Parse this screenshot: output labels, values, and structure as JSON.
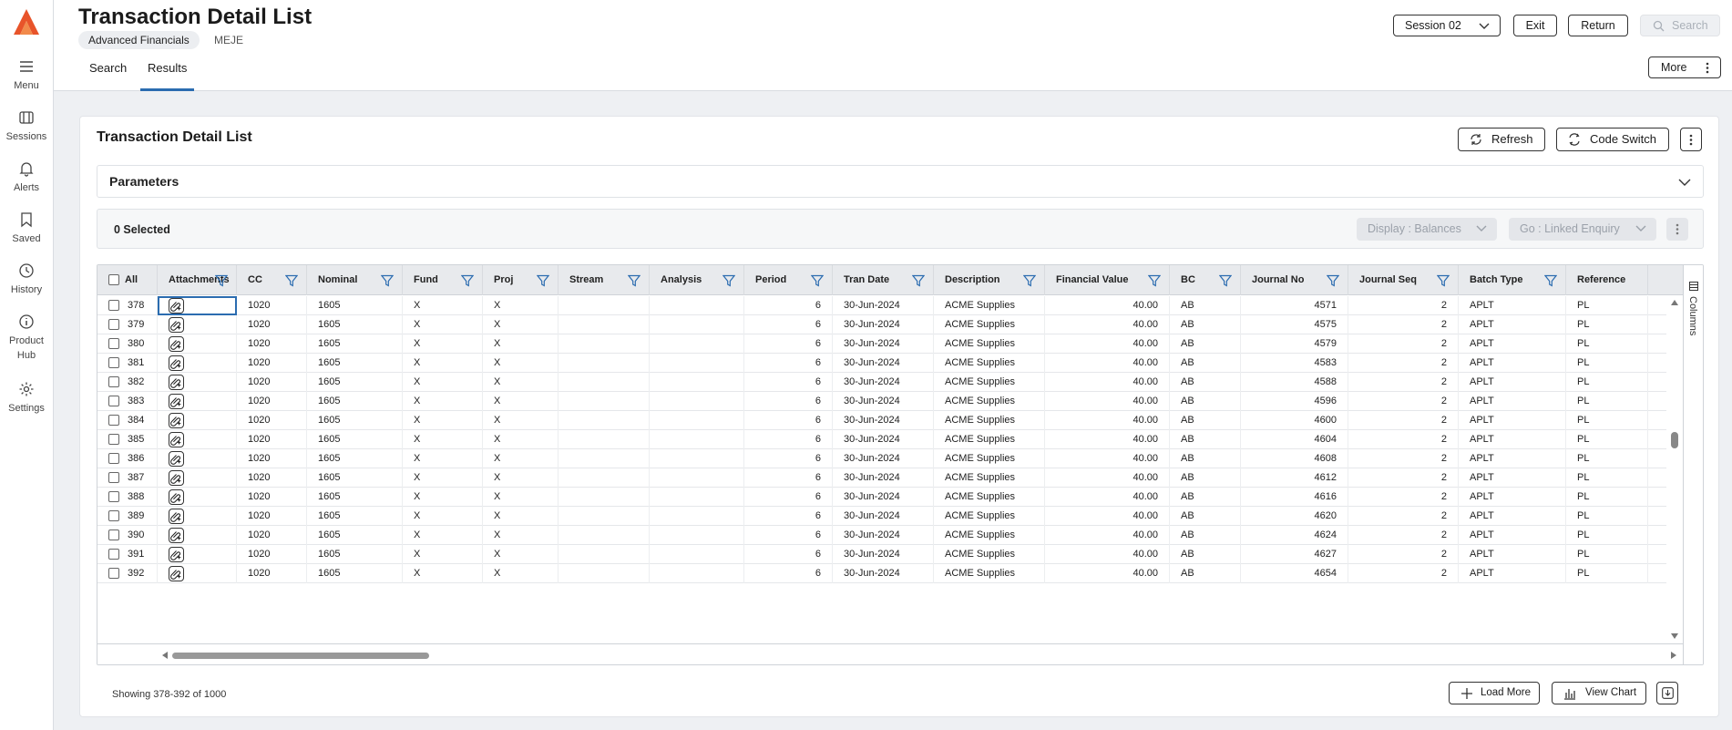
{
  "nav": {
    "items": [
      {
        "label": "Menu",
        "icon": "menu-icon"
      },
      {
        "label": "Sessions",
        "icon": "sessions-icon"
      },
      {
        "label": "Alerts",
        "icon": "bell-icon"
      },
      {
        "label": "Saved",
        "icon": "bookmark-icon"
      },
      {
        "label": "History",
        "icon": "clock-icon"
      },
      {
        "label": "Product",
        "label2": "Hub",
        "icon": "info-icon"
      },
      {
        "label": "Settings",
        "icon": "gear-icon"
      }
    ]
  },
  "header": {
    "title": "Transaction Detail List",
    "chip": "Advanced Financials",
    "code": "MEJE",
    "tabs": [
      "Search",
      "Results"
    ],
    "session": "Session 02",
    "exit": "Exit",
    "return": "Return",
    "search": "Search",
    "more": "More"
  },
  "card": {
    "title": "Transaction Detail List",
    "refresh": "Refresh",
    "code_switch": "Code Switch",
    "parameters": "Parameters",
    "selected": "0 Selected",
    "display": "Display : Balances",
    "go": "Go : Linked Enquiry"
  },
  "grid": {
    "all_label": "All",
    "columns": [
      "Attachments",
      "CC",
      "Nominal",
      "Fund",
      "Proj",
      "Stream",
      "Analysis",
      "Period",
      "Tran Date",
      "Description",
      "Financial Value",
      "BC",
      "Journal No",
      "Journal Seq",
      "Batch Type",
      "Reference"
    ],
    "columns_panel": "Columns",
    "rows": [
      {
        "n": "378",
        "cc": "1020",
        "nominal": "1605",
        "fund": "X",
        "proj": "X",
        "stream": "",
        "analysis": "",
        "period": "6",
        "date": "30-Jun-2024",
        "desc": "ACME Supplies",
        "value": "40.00",
        "bc": "AB",
        "jno": "4571",
        "jseq": "2",
        "btype": "APLT",
        "ref": "PL"
      },
      {
        "n": "379",
        "cc": "1020",
        "nominal": "1605",
        "fund": "X",
        "proj": "X",
        "stream": "",
        "analysis": "",
        "period": "6",
        "date": "30-Jun-2024",
        "desc": "ACME Supplies",
        "value": "40.00",
        "bc": "AB",
        "jno": "4575",
        "jseq": "2",
        "btype": "APLT",
        "ref": "PL"
      },
      {
        "n": "380",
        "cc": "1020",
        "nominal": "1605",
        "fund": "X",
        "proj": "X",
        "stream": "",
        "analysis": "",
        "period": "6",
        "date": "30-Jun-2024",
        "desc": "ACME Supplies",
        "value": "40.00",
        "bc": "AB",
        "jno": "4579",
        "jseq": "2",
        "btype": "APLT",
        "ref": "PL"
      },
      {
        "n": "381",
        "cc": "1020",
        "nominal": "1605",
        "fund": "X",
        "proj": "X",
        "stream": "",
        "analysis": "",
        "period": "6",
        "date": "30-Jun-2024",
        "desc": "ACME Supplies",
        "value": "40.00",
        "bc": "AB",
        "jno": "4583",
        "jseq": "2",
        "btype": "APLT",
        "ref": "PL"
      },
      {
        "n": "382",
        "cc": "1020",
        "nominal": "1605",
        "fund": "X",
        "proj": "X",
        "stream": "",
        "analysis": "",
        "period": "6",
        "date": "30-Jun-2024",
        "desc": "ACME Supplies",
        "value": "40.00",
        "bc": "AB",
        "jno": "4588",
        "jseq": "2",
        "btype": "APLT",
        "ref": "PL"
      },
      {
        "n": "383",
        "cc": "1020",
        "nominal": "1605",
        "fund": "X",
        "proj": "X",
        "stream": "",
        "analysis": "",
        "period": "6",
        "date": "30-Jun-2024",
        "desc": "ACME Supplies",
        "value": "40.00",
        "bc": "AB",
        "jno": "4596",
        "jseq": "2",
        "btype": "APLT",
        "ref": "PL"
      },
      {
        "n": "384",
        "cc": "1020",
        "nominal": "1605",
        "fund": "X",
        "proj": "X",
        "stream": "",
        "analysis": "",
        "period": "6",
        "date": "30-Jun-2024",
        "desc": "ACME Supplies",
        "value": "40.00",
        "bc": "AB",
        "jno": "4600",
        "jseq": "2",
        "btype": "APLT",
        "ref": "PL"
      },
      {
        "n": "385",
        "cc": "1020",
        "nominal": "1605",
        "fund": "X",
        "proj": "X",
        "stream": "",
        "analysis": "",
        "period": "6",
        "date": "30-Jun-2024",
        "desc": "ACME Supplies",
        "value": "40.00",
        "bc": "AB",
        "jno": "4604",
        "jseq": "2",
        "btype": "APLT",
        "ref": "PL"
      },
      {
        "n": "386",
        "cc": "1020",
        "nominal": "1605",
        "fund": "X",
        "proj": "X",
        "stream": "",
        "analysis": "",
        "period": "6",
        "date": "30-Jun-2024",
        "desc": "ACME Supplies",
        "value": "40.00",
        "bc": "AB",
        "jno": "4608",
        "jseq": "2",
        "btype": "APLT",
        "ref": "PL"
      },
      {
        "n": "387",
        "cc": "1020",
        "nominal": "1605",
        "fund": "X",
        "proj": "X",
        "stream": "",
        "analysis": "",
        "period": "6",
        "date": "30-Jun-2024",
        "desc": "ACME Supplies",
        "value": "40.00",
        "bc": "AB",
        "jno": "4612",
        "jseq": "2",
        "btype": "APLT",
        "ref": "PL"
      },
      {
        "n": "388",
        "cc": "1020",
        "nominal": "1605",
        "fund": "X",
        "proj": "X",
        "stream": "",
        "analysis": "",
        "period": "6",
        "date": "30-Jun-2024",
        "desc": "ACME Supplies",
        "value": "40.00",
        "bc": "AB",
        "jno": "4616",
        "jseq": "2",
        "btype": "APLT",
        "ref": "PL"
      },
      {
        "n": "389",
        "cc": "1020",
        "nominal": "1605",
        "fund": "X",
        "proj": "X",
        "stream": "",
        "analysis": "",
        "period": "6",
        "date": "30-Jun-2024",
        "desc": "ACME Supplies",
        "value": "40.00",
        "bc": "AB",
        "jno": "4620",
        "jseq": "2",
        "btype": "APLT",
        "ref": "PL"
      },
      {
        "n": "390",
        "cc": "1020",
        "nominal": "1605",
        "fund": "X",
        "proj": "X",
        "stream": "",
        "analysis": "",
        "period": "6",
        "date": "30-Jun-2024",
        "desc": "ACME Supplies",
        "value": "40.00",
        "bc": "AB",
        "jno": "4624",
        "jseq": "2",
        "btype": "APLT",
        "ref": "PL"
      },
      {
        "n": "391",
        "cc": "1020",
        "nominal": "1605",
        "fund": "X",
        "proj": "X",
        "stream": "",
        "analysis": "",
        "period": "6",
        "date": "30-Jun-2024",
        "desc": "ACME Supplies",
        "value": "40.00",
        "bc": "AB",
        "jno": "4627",
        "jseq": "2",
        "btype": "APLT",
        "ref": "PL"
      },
      {
        "n": "392",
        "cc": "1020",
        "nominal": "1605",
        "fund": "X",
        "proj": "X",
        "stream": "",
        "analysis": "",
        "period": "6",
        "date": "30-Jun-2024",
        "desc": "ACME Supplies",
        "value": "40.00",
        "bc": "AB",
        "jno": "4654",
        "jseq": "2",
        "btype": "APLT",
        "ref": "PL"
      }
    ]
  },
  "footer": {
    "showing": "Showing 378-392 of 1000",
    "load_more": "Load More",
    "view_chart": "View Chart"
  },
  "colors": {
    "accent": "#2b6cb0",
    "logo": "#e8542a",
    "filter": "#2b6cb0"
  }
}
